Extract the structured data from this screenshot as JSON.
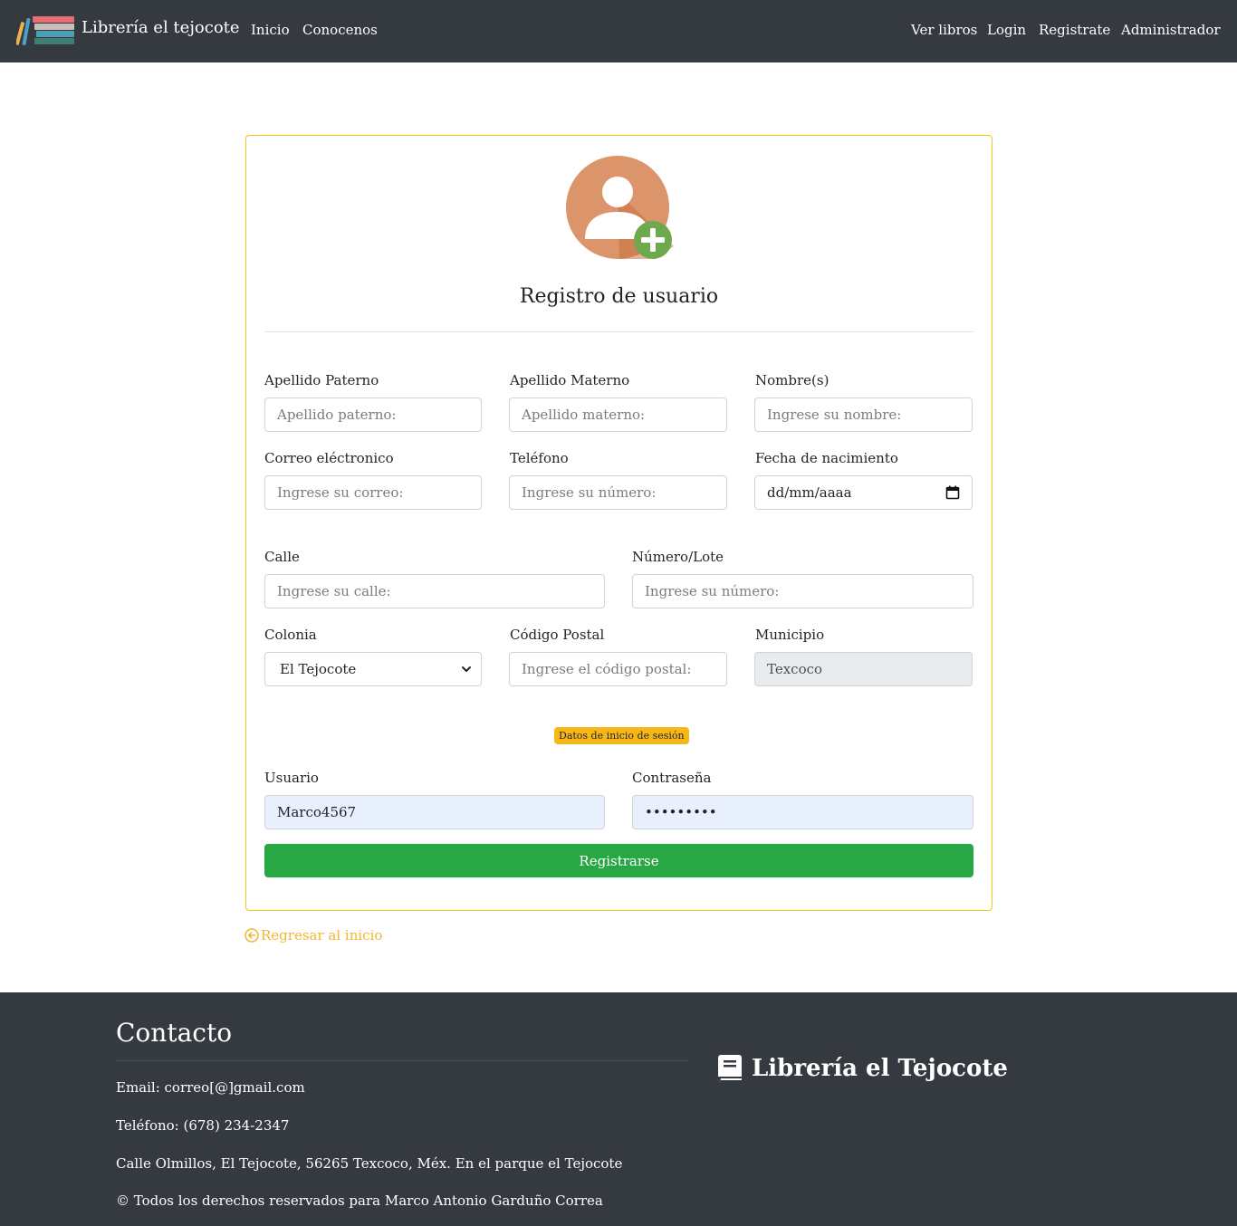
{
  "navbar": {
    "brand": "Librería el tejocote",
    "links_left": [
      "Inicio",
      "Conocenos"
    ],
    "links_right": [
      "Ver libros",
      "Login",
      "Registrate",
      "Administrador"
    ]
  },
  "form": {
    "title": "Registro de usuario",
    "apellido_paterno": {
      "label": "Apellido Paterno",
      "placeholder": "Apellido paterno:"
    },
    "apellido_materno": {
      "label": "Apellido Materno",
      "placeholder": "Apellido materno:"
    },
    "nombre": {
      "label": "Nombre(s)",
      "placeholder": "Ingrese su nombre:"
    },
    "correo": {
      "label": "Correo eléctronico",
      "placeholder": "Ingrese su correo:"
    },
    "telefono": {
      "label": "Teléfono",
      "placeholder": "Ingrese su número:"
    },
    "fecha": {
      "label": "Fecha de nacimiento",
      "value": "dd/mm/aaaa"
    },
    "calle": {
      "label": "Calle",
      "placeholder": "Ingrese su calle:"
    },
    "numero": {
      "label": "Número/Lote",
      "placeholder": "Ingrese su número:"
    },
    "colonia": {
      "label": "Colonia",
      "value": "El Tejocote"
    },
    "cp": {
      "label": "Código Postal",
      "placeholder": "Ingrese el código postal:"
    },
    "municipio": {
      "label": "Municipio",
      "value": "Texcoco"
    },
    "badge": "Datos de inicio de sesión",
    "usuario": {
      "label": "Usuario",
      "value": "Marco4567"
    },
    "contrasena": {
      "label": "Contraseña",
      "value": "•••••••••"
    },
    "submit": "Registrarse"
  },
  "back_link": "Regresar al inicio",
  "footer": {
    "title": "Contacto",
    "email": "Email: correo[@]gmail.com",
    "telefono": "Teléfono: (678) 234-2347",
    "direccion": "Calle Olmillos, El Tejocote, 56265 Texcoco, Méx. En el parque el Tejocote",
    "copyright": "© Todos los derechos reservados para Marco Antonio Garduño Correa",
    "brand": "Librería el Tejocote"
  },
  "colors": {
    "navbar": "#343a40",
    "card_border": "#f2c811",
    "submit": "#28a745",
    "badge": "#f8b719",
    "link": "#f2b632"
  }
}
